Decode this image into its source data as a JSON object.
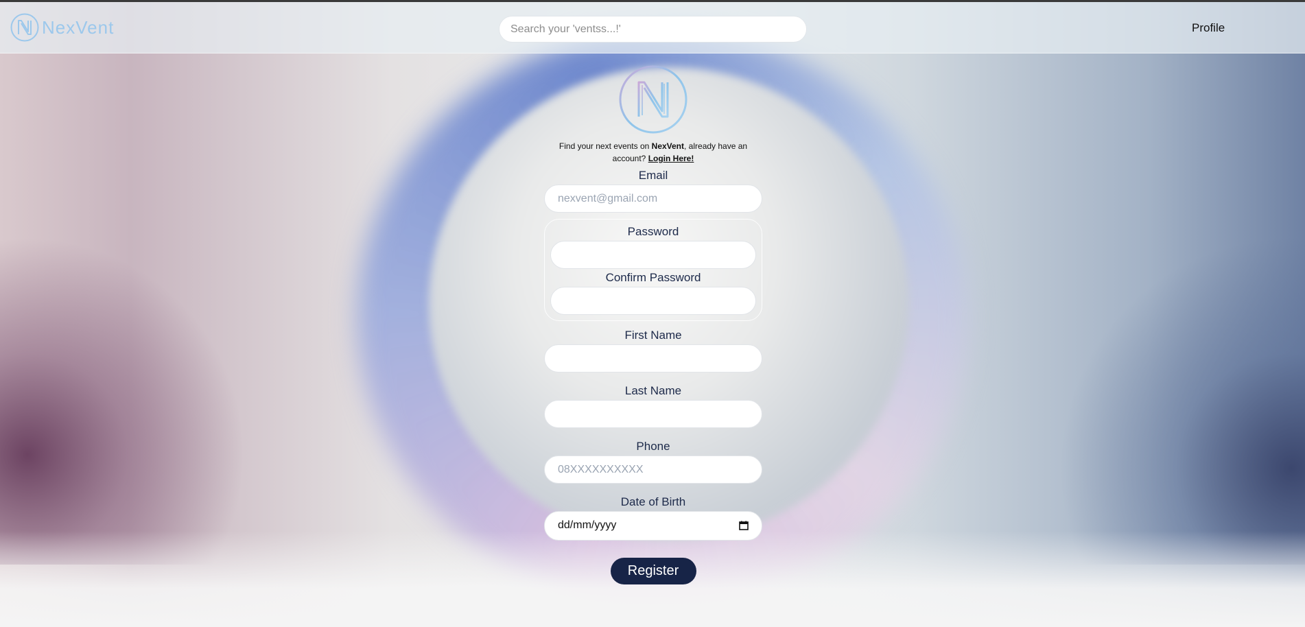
{
  "header": {
    "logo_text": "NexVent",
    "search_placeholder": "Search your 'ventss...!'",
    "profile_label": "Profile"
  },
  "form": {
    "intro_prefix": "Find your next events on ",
    "intro_brand": "NexVent",
    "intro_suffix": ", already have an account? ",
    "login_link": "Login Here!",
    "email_label": "Email",
    "email_placeholder": "nexvent@gmail.com",
    "password_label": "Password",
    "confirm_password_label": "Confirm Password",
    "first_name_label": "First Name",
    "last_name_label": "Last Name",
    "phone_label": "Phone",
    "phone_placeholder": "08XXXXXXXXXX",
    "dob_label": "Date of Birth",
    "dob_value": "dd/mm/yyyy",
    "register_label": "Register"
  },
  "colors": {
    "accent": "#172447",
    "logo": "#9cc8ec"
  },
  "icons": [
    "nexvent-logo-icon",
    "calendar-icon"
  ]
}
